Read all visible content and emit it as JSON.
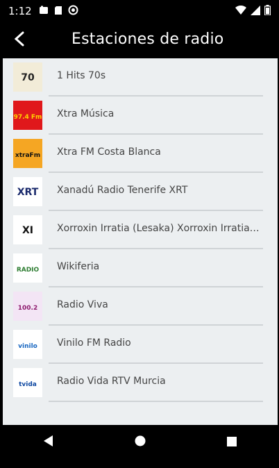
{
  "status_bar": {
    "time": "1:12",
    "icons": [
      "image-icon",
      "sd-card-icon",
      "no-disturb-icon",
      "wifi-icon",
      "signal-icon",
      "battery-icon"
    ]
  },
  "app_bar": {
    "title": "Estaciones de radio",
    "back_icon": "back-arrow-icon"
  },
  "stations": [
    {
      "name": "1 Hits 70s",
      "logo_text": "70",
      "logo_fg": "#222222",
      "logo_bg": "#f2ecd8"
    },
    {
      "name": "Xtra Música",
      "logo_text": "97.4 Fm",
      "logo_fg": "#ffd200",
      "logo_bg": "#e0181b"
    },
    {
      "name": "Xtra FM Costa Blanca",
      "logo_text": "xtraFm",
      "logo_fg": "#111111",
      "logo_bg": "#f5a623"
    },
    {
      "name": "Xanadú Radio Tenerife XRT",
      "logo_text": "XRT",
      "logo_fg": "#1a2a6c",
      "logo_bg": "#ffffff"
    },
    {
      "name": "Xorroxin Irratia (Lesaka) Xorroxin Irratia Lesaka",
      "logo_text": "XI",
      "logo_fg": "#111111",
      "logo_bg": "#ffffff"
    },
    {
      "name": "Wikiferia",
      "logo_text": "RADIO",
      "logo_fg": "#2e7d32",
      "logo_bg": "#ffffff"
    },
    {
      "name": "Radio Viva",
      "logo_text": "100.2",
      "logo_fg": "#8e1b6e",
      "logo_bg": "#f3e5f5"
    },
    {
      "name": "Vinilo FM Radio",
      "logo_text": "vinilo",
      "logo_fg": "#1565c0",
      "logo_bg": "#ffffff"
    },
    {
      "name": "Radio Vida RTV Murcia",
      "logo_text": "tvida",
      "logo_fg": "#0d47a1",
      "logo_bg": "#ffffff"
    }
  ],
  "nav_bar": {
    "back_icon": "nav-back-triangle-icon",
    "home_icon": "nav-home-circle-icon",
    "recents_icon": "nav-recents-square-icon"
  },
  "colors": {
    "status_bar": "#000000",
    "app_bar": "#000000",
    "list_background": "#eceff1",
    "divider": "#cfd3d6",
    "text": "#444444"
  }
}
